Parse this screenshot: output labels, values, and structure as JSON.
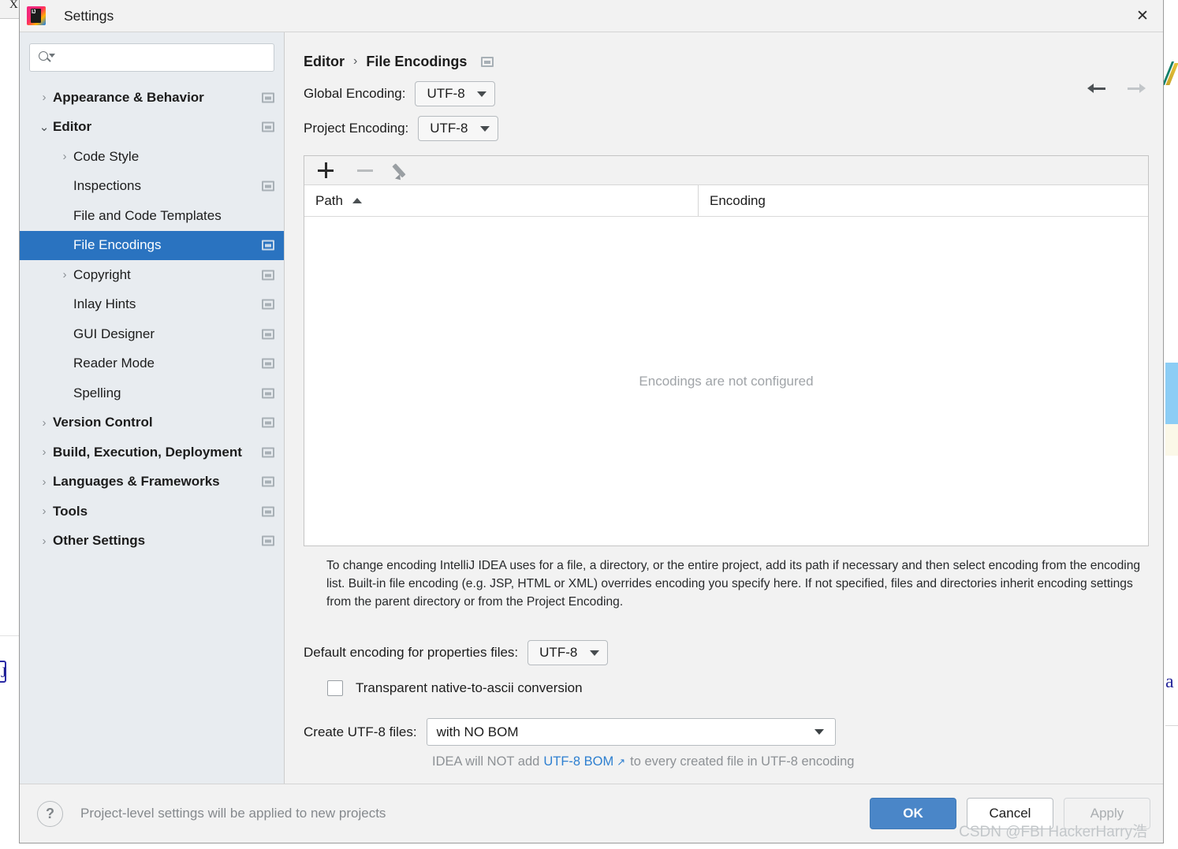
{
  "window": {
    "title": "Settings",
    "logo_text": "IJ",
    "close_icon": "✕"
  },
  "sidebar": {
    "search": {
      "value": "",
      "placeholder": ""
    },
    "items": [
      {
        "label": "Appearance & Behavior",
        "level": 0,
        "arrow": "›",
        "bold": true,
        "badge": true,
        "selected": false
      },
      {
        "label": "Editor",
        "level": 0,
        "arrow": "⌄",
        "bold": true,
        "badge": true,
        "selected": false,
        "expanded": true
      },
      {
        "label": "Code Style",
        "level": 1,
        "arrow": "›",
        "bold": false,
        "badge": false,
        "selected": false
      },
      {
        "label": "Inspections",
        "level": 1,
        "arrow": "",
        "bold": false,
        "badge": true,
        "selected": false
      },
      {
        "label": "File and Code Templates",
        "level": 1,
        "arrow": "",
        "bold": false,
        "badge": false,
        "selected": false
      },
      {
        "label": "File Encodings",
        "level": 1,
        "arrow": "",
        "bold": false,
        "badge": true,
        "selected": true
      },
      {
        "label": "Copyright",
        "level": 1,
        "arrow": "›",
        "bold": false,
        "badge": true,
        "selected": false
      },
      {
        "label": "Inlay Hints",
        "level": 1,
        "arrow": "",
        "bold": false,
        "badge": true,
        "selected": false
      },
      {
        "label": "GUI Designer",
        "level": 1,
        "arrow": "",
        "bold": false,
        "badge": true,
        "selected": false
      },
      {
        "label": "Reader Mode",
        "level": 1,
        "arrow": "",
        "bold": false,
        "badge": true,
        "selected": false
      },
      {
        "label": "Spelling",
        "level": 1,
        "arrow": "",
        "bold": false,
        "badge": true,
        "selected": false
      },
      {
        "label": "Version Control",
        "level": 0,
        "arrow": "›",
        "bold": true,
        "badge": true,
        "selected": false
      },
      {
        "label": "Build, Execution, Deployment",
        "level": 0,
        "arrow": "›",
        "bold": true,
        "badge": true,
        "selected": false
      },
      {
        "label": "Languages & Frameworks",
        "level": 0,
        "arrow": "›",
        "bold": true,
        "badge": true,
        "selected": false
      },
      {
        "label": "Tools",
        "level": 0,
        "arrow": "›",
        "bold": true,
        "badge": true,
        "selected": false
      },
      {
        "label": "Other Settings",
        "level": 0,
        "arrow": "›",
        "bold": true,
        "badge": true,
        "selected": false
      }
    ]
  },
  "content": {
    "breadcrumb": {
      "parent": "Editor",
      "separator": "›",
      "current": "File Encodings"
    },
    "global_encoding": {
      "label": "Global Encoding:",
      "value": "UTF-8"
    },
    "project_encoding": {
      "label": "Project Encoding:",
      "value": "UTF-8"
    },
    "toolbar": {
      "add_icon": "plus-icon",
      "remove_icon": "minus-icon",
      "edit_icon": "pencil-icon"
    },
    "table": {
      "columns": [
        "Path",
        "Encoding"
      ],
      "sort_column": "Path",
      "sort_direction": "ascending",
      "rows": [],
      "empty_message": "Encodings are not configured"
    },
    "description": "To change encoding IntelliJ IDEA uses for a file, a directory, or the entire project, add its path if necessary and then select encoding from the encoding list. Built-in file encoding (e.g. JSP, HTML or XML) overrides encoding you specify here. If not specified, files and directories inherit encoding settings from the parent directory or from the Project Encoding.",
    "properties_encoding": {
      "label": "Default encoding for properties files:",
      "value": "UTF-8"
    },
    "transparent_checkbox": {
      "label": "Transparent native-to-ascii conversion",
      "checked": false
    },
    "create_utf8": {
      "label": "Create UTF-8 files:",
      "value": "with NO BOM"
    },
    "bom_hint": {
      "prefix": "IDEA will NOT add",
      "link": "UTF-8 BOM",
      "link_icon": "↗",
      "suffix": "to every created file in UTF-8 encoding"
    }
  },
  "footer": {
    "help_icon": "?",
    "note": "Project-level settings will be applied to new projects",
    "ok_label": "OK",
    "cancel_label": "Cancel",
    "apply_label": "Apply",
    "apply_disabled": true,
    "watermark": "CSDN @FBI HackerHarry浩"
  },
  "colors": {
    "selection_blue": "#2a73c0",
    "ok_blue": "#4a86c8",
    "link_blue": "#2d7fd0",
    "sidebar_bg": "#e8ecf0",
    "dialog_bg": "#f2f2f2"
  }
}
